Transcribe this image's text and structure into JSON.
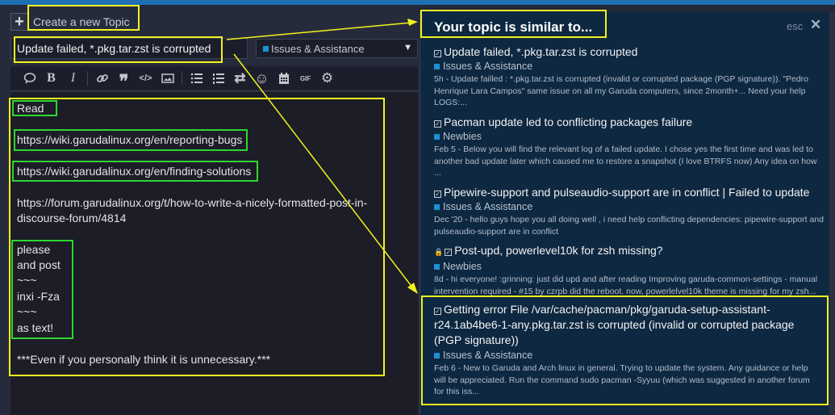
{
  "composer": {
    "add_icon": "plus-icon",
    "heading": "Create a new Topic",
    "title_value": "Update failed, *.pkg.tar.zst is corrupted",
    "category": {
      "label": "Issues & Assistance",
      "color": "#1e90d6"
    },
    "toolbar": [
      {
        "name": "quote-icon",
        "glyph": "speech"
      },
      {
        "name": "bold-icon",
        "glyph": "B"
      },
      {
        "name": "italic-icon",
        "glyph": "I"
      },
      {
        "name": "link-icon",
        "glyph": "link"
      },
      {
        "name": "blockquote-icon",
        "glyph": "❞"
      },
      {
        "name": "code-icon",
        "glyph": "</>"
      },
      {
        "name": "image-icon",
        "glyph": "img"
      },
      {
        "name": "bullet-list-icon",
        "glyph": "ul"
      },
      {
        "name": "numbered-list-icon",
        "glyph": "ol"
      },
      {
        "name": "toggle-direction-icon",
        "glyph": "⇄"
      },
      {
        "name": "emoji-icon",
        "glyph": "☺"
      },
      {
        "name": "calendar-icon",
        "glyph": "cal"
      },
      {
        "name": "gif-icon",
        "glyph": "GIF"
      },
      {
        "name": "gear-icon",
        "glyph": "⚙"
      }
    ],
    "body_lines": {
      "read": "Read",
      "link1": "https://wiki.garudalinux.org/en/reporting-bugs",
      "link2": "https://wiki.garudalinux.org/en/finding-solutions",
      "link3a": "https://forum.garudalinux.org/t/how-to-write-a-nicely-formatted-post-in-",
      "link3b": "discourse-forum/4814",
      "p1": "please",
      "p2": "and post",
      "p3": "~~~",
      "p4": "inxi -Fza",
      "p5": "~~~",
      "p6": "as text!",
      "footer": "***Even if you personally think it is unnecessary.***"
    }
  },
  "similar": {
    "title": "Your topic is similar to...",
    "esc_label": "esc",
    "close_icon": "close-icon",
    "items": [
      {
        "title": "Update failed, *.pkg.tar.zst is corrupted",
        "locked": false,
        "category": "Issues & Assistance",
        "excerpt": "5h - Update failled : *.pkg.tar.zst is corrupted (invalid or corrupted package (PGP signature)). \"Pedro Henrique Lara Campos\" same issue on all my Garuda computers, since 2month+... Need your help LOGS:..."
      },
      {
        "title": "Pacman update led to conflicting packages failure",
        "locked": false,
        "category": "Newbies",
        "excerpt": "Feb 5 - Below you will find the relevant log of a failed update. I chose yes the first time and was led to another bad update later which caused me to restore a snapshot (I love BTRFS now) Any idea on how ..."
      },
      {
        "title": "Pipewire-support and pulseaudio-support are in conflict | Failed to update",
        "locked": false,
        "category": "Issues & Assistance",
        "excerpt": "Dec '20 - hello guys hope you all doing well , i need help conflicting dependencies: pipewire-support and pulseaudio-support are in conflict"
      },
      {
        "title": "Post-upd, powerlevel10k for zsh missing?",
        "locked": true,
        "category": "Newbies",
        "excerpt": "8d - hi everyone! :grinning: just did upd and after reading Improving garuda-common-settings - manual intervention required - #15 by czrpb did the reboot. now, powerlelvel10k theme is missing for my zsh..."
      },
      {
        "title": "Getting error File /var/cache/pacman/pkg/garuda-setup-assistant-r24.1ab4be6-1-any.pkg.tar.zst is corrupted (invalid or corrupted package (PGP signature))",
        "locked": false,
        "category": "Issues & Assistance",
        "excerpt": "Feb 6 - New to Garuda and Arch linux in general. Trying to update the system. Any guidance or help will be appreciated. Run the command sudo pacman -Syyuu (which was suggested in another forum for this iss..."
      }
    ]
  },
  "annotations": {
    "highlight_color": "#f2f21e",
    "secondary_color": "#2fd62f"
  }
}
